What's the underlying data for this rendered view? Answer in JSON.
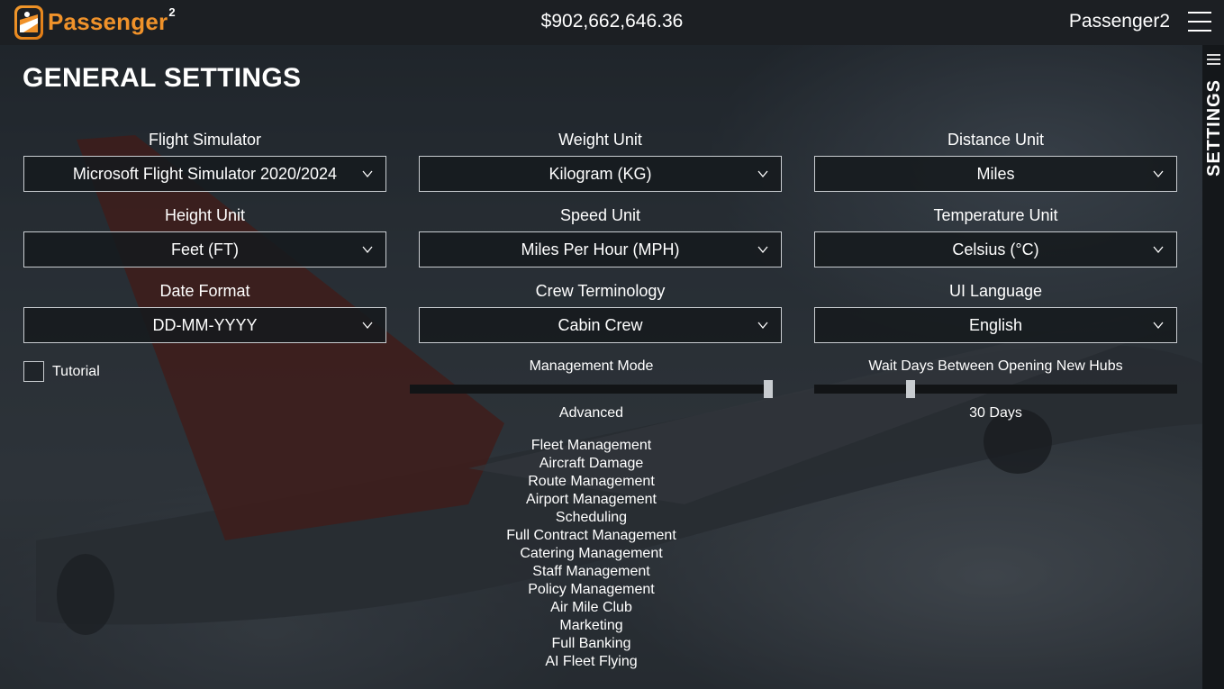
{
  "header": {
    "logo_text": "Passenger",
    "logo_superscript": "2",
    "balance": "$902,662,646.36",
    "username": "Passenger2"
  },
  "sidebar": {
    "label": "SETTINGS"
  },
  "page": {
    "title": "GENERAL SETTINGS"
  },
  "fields": {
    "flight_simulator": {
      "label": "Flight Simulator",
      "value": "Microsoft Flight Simulator 2020/2024"
    },
    "weight_unit": {
      "label": "Weight Unit",
      "value": "Kilogram (KG)"
    },
    "distance_unit": {
      "label": "Distance Unit",
      "value": "Miles"
    },
    "height_unit": {
      "label": "Height Unit",
      "value": "Feet (FT)"
    },
    "speed_unit": {
      "label": "Speed Unit",
      "value": "Miles Per Hour (MPH)"
    },
    "temperature_unit": {
      "label": "Temperature Unit",
      "value": "Celsius (°C)"
    },
    "date_format": {
      "label": "Date Format",
      "value": "DD-MM-YYYY"
    },
    "crew_terminology": {
      "label": "Crew Terminology",
      "value": "Cabin Crew"
    },
    "ui_language": {
      "label": "UI Language",
      "value": "English"
    }
  },
  "tutorial": {
    "label": "Tutorial",
    "checked": false
  },
  "management_mode": {
    "label": "Management Mode",
    "value": "Advanced",
    "slider_fraction": 1.0,
    "features": [
      "Fleet Management",
      "Aircraft Damage",
      "Route Management",
      "Airport Management",
      "Scheduling",
      "Full Contract Management",
      "Catering Management",
      "Staff Management",
      "Policy Management",
      "Air Mile Club",
      "Marketing",
      "Full Banking",
      "AI Fleet Flying"
    ]
  },
  "wait_days": {
    "label": "Wait Days Between Opening New Hubs",
    "value": "30 Days",
    "slider_fraction": 0.26
  },
  "colors": {
    "accent": "#f0922a",
    "topbar": "#1c1f23",
    "sidebar": "#14171a"
  }
}
